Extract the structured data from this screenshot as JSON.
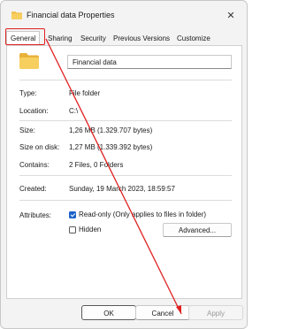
{
  "window": {
    "title": "Financial data Properties",
    "close_glyph": "✕"
  },
  "tabs": [
    {
      "label": "General",
      "active": true
    },
    {
      "label": "Sharing"
    },
    {
      "label": "Security"
    },
    {
      "label": "Previous Versions"
    },
    {
      "label": "Customize"
    }
  ],
  "general": {
    "folder_name": "Financial data",
    "rows": [
      {
        "label": "Type:",
        "value": "File folder"
      },
      {
        "label": "Location:",
        "value": "C:\\"
      },
      {
        "label": "Size:",
        "value": "1,26 MB (1.329.707 bytes)"
      },
      {
        "label": "Size on disk:",
        "value": "1,27 MB (1.339.392 bytes)"
      },
      {
        "label": "Contains:",
        "value": "2 Files, 0 Folders"
      },
      {
        "label": "Created:",
        "value": "Sunday, 19 March 2023, 18:59:57"
      }
    ],
    "attributes": {
      "label": "Attributes:",
      "readonly": {
        "label": "Read-only (Only applies to files in folder)",
        "checked": true
      },
      "hidden": {
        "label": "Hidden",
        "checked": false
      },
      "advanced_label": "Advanced..."
    }
  },
  "buttons": {
    "ok": "OK",
    "cancel": "Cancel",
    "apply": "Apply"
  },
  "colors": {
    "annotation": "#e02020",
    "checkbox_accent": "#1a63c9",
    "folder_yellow": "#f2c14e"
  },
  "icons": {
    "title": "folder-icon",
    "close": "close-icon",
    "folder": "folder-icon",
    "annotation": "arrow-annotation"
  }
}
